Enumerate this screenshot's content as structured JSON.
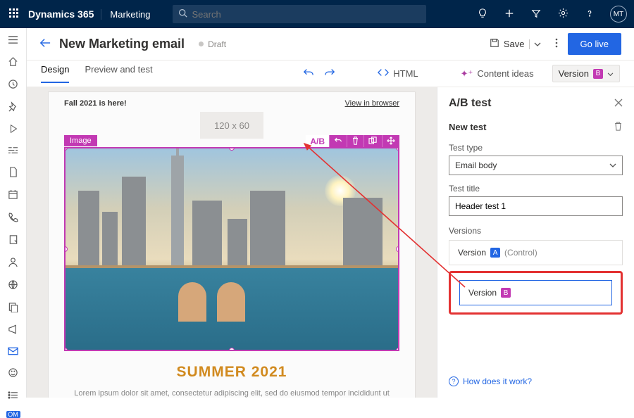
{
  "header": {
    "brand": "Dynamics 365",
    "app": "Marketing",
    "searchPlaceholder": "Search",
    "avatar": "MT"
  },
  "page": {
    "title": "New Marketing email",
    "status": "Draft",
    "save": "Save",
    "golive": "Go live",
    "tabs": {
      "design": "Design",
      "preview": "Preview and test"
    },
    "html": "HTML",
    "ideas": "Content ideas",
    "versionPill": "Version"
  },
  "email": {
    "tagline": "Fall 2021 is here!",
    "viewInBrowser": "View in browser",
    "logoPlaceholder": "120 x 60",
    "imageLabel": "Image",
    "abBadge": "A/B",
    "headline": "SUMMER 2021",
    "lorem": "Lorem ipsum dolor sit amet, consectetur adipiscing elit, sed do eiusmod tempor incididunt ut labore et dolore magna aliqua."
  },
  "panel": {
    "title": "A/B test",
    "newTest": "New test",
    "testTypeLabel": "Test type",
    "testTypeValue": "Email body",
    "testTitleLabel": "Test title",
    "testTitleValue": "Header test 1",
    "versionsLabel": "Versions",
    "versionWord": "Version",
    "control": "(Control)",
    "help": "How does it work?"
  },
  "om": "OM"
}
